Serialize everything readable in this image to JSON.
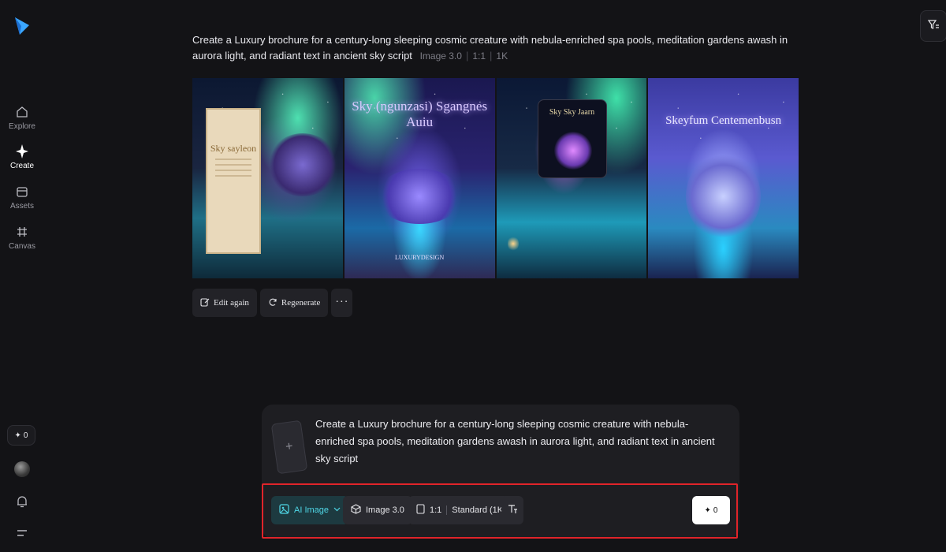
{
  "sidebar": {
    "items": [
      {
        "label": "Explore"
      },
      {
        "label": "Create"
      },
      {
        "label": "Assets"
      },
      {
        "label": "Canvas"
      }
    ],
    "credits": "0"
  },
  "generation": {
    "prompt": "Create a Luxury brochure for a century-long sleeping cosmic creature with nebula-enriched spa pools, meditation gardens awash in aurora light, and radiant text in ancient sky script",
    "model": "Image 3.0",
    "ratio": "1:1",
    "resolution": "1K",
    "images": [
      {
        "caption": "Sky sayleon"
      },
      {
        "caption": "Sky (ngunzasi) Sgangnes Auiu",
        "footer": "LUXURYDESIGN"
      },
      {
        "caption": "Sky Sky Jaarn"
      },
      {
        "caption": "Skeyfum Centemenbusn"
      }
    ]
  },
  "actions": {
    "edit_again": "Edit again",
    "regenerate": "Regenerate",
    "more": "···"
  },
  "composer": {
    "text": "Create a Luxury brochure for a century-long sleeping cosmic creature with nebula-enriched spa pools, meditation gardens awash in aurora light, and radiant text in ancient sky script",
    "mode": "AI Image",
    "model": "Image 3.0",
    "ratio": "1:1",
    "quality": "Standard (1K)",
    "generate_credits": "0"
  },
  "colors": {
    "accent": "#4fd6e6",
    "highlight_border": "#e0242a"
  }
}
